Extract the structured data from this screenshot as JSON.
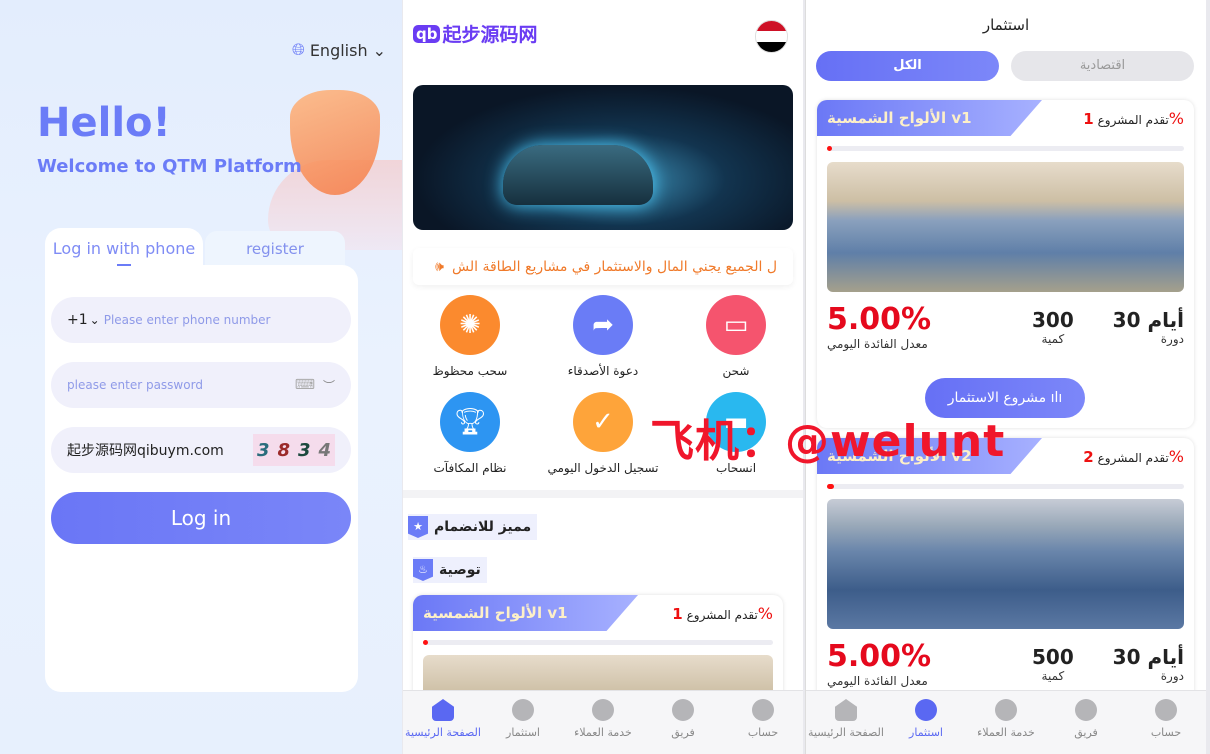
{
  "login": {
    "language": "English",
    "hello": "Hello!",
    "welcome": "Welcome to QTM Platform",
    "tab_phone": "Log in with phone",
    "tab_register": "register",
    "country_code": "+1",
    "phone_placeholder": "Please enter phone number",
    "password_placeholder": "please enter password",
    "captcha_input": "起步源码网qibuym.com",
    "captcha_code": [
      "3",
      "8",
      "3",
      "4"
    ],
    "login_button": "Log in"
  },
  "home": {
    "logo_mark": "qb",
    "logo_text": "起步源码网",
    "marquee": "ل الجميع يجني المال والاستثمار في مشاريع الطاقة الش",
    "actions": [
      {
        "label": "شحن",
        "icon": "wallet-icon",
        "color": "#f5546e"
      },
      {
        "label": "دعوة الأصدقاء",
        "icon": "share-icon",
        "color": "#6a7cf6"
      },
      {
        "label": "سحب محظوظ",
        "icon": "wheel-icon",
        "color": "#fb8a2e"
      },
      {
        "label": "انسحاب",
        "icon": "card-icon",
        "color": "#29b8ef"
      },
      {
        "label": "تسجيل الدخول اليومي",
        "icon": "calendar-check-icon",
        "color": "#fea43a"
      },
      {
        "label": "نظام المكافآت",
        "icon": "trophy-icon",
        "color": "#2d95f2"
      }
    ],
    "section_featured": "مميز للانضمام",
    "section_recommend": "توصية",
    "card": {
      "title": "الألواح الشمسية v1",
      "progress_label": "تقدم المشروع",
      "progress_value": "1",
      "progress_pct": "%",
      "progress": 1
    }
  },
  "invest": {
    "title": "استثمار",
    "tab_all": "الكل",
    "tab_economic": "اقتصادية",
    "products": [
      {
        "title": "الألواح الشمسية v1",
        "progress_label": "تقدم المشروع",
        "progress_value": "1",
        "progress_pct": "%",
        "progress": 1,
        "rate": "5.00%",
        "rate_label": "معدل الفائدة اليومي",
        "quantity": "300",
        "quantity_label": "كمية",
        "period": "أيام 30",
        "period_label": "دورة",
        "button": "مشروع الاستثمار"
      },
      {
        "title": "الألواح الشمسية v2",
        "progress_label": "تقدم المشروع",
        "progress_value": "2",
        "progress_pct": "%",
        "progress": 2,
        "rate": "5.00%",
        "rate_label": "معدل الفائدة اليومي",
        "quantity": "500",
        "quantity_label": "كمية",
        "period": "أيام 30",
        "period_label": "دورة"
      }
    ]
  },
  "nav": {
    "home": "الصفحة الرئيسية",
    "invest": "استثمار",
    "service": "خدمة العملاء",
    "team": "فريق",
    "account": "حساب"
  },
  "watermark": "飞机：@welunt",
  "colors": {
    "accent": "#6b7cf7",
    "red": "#e5091d",
    "marquee": "#f07a2a"
  }
}
